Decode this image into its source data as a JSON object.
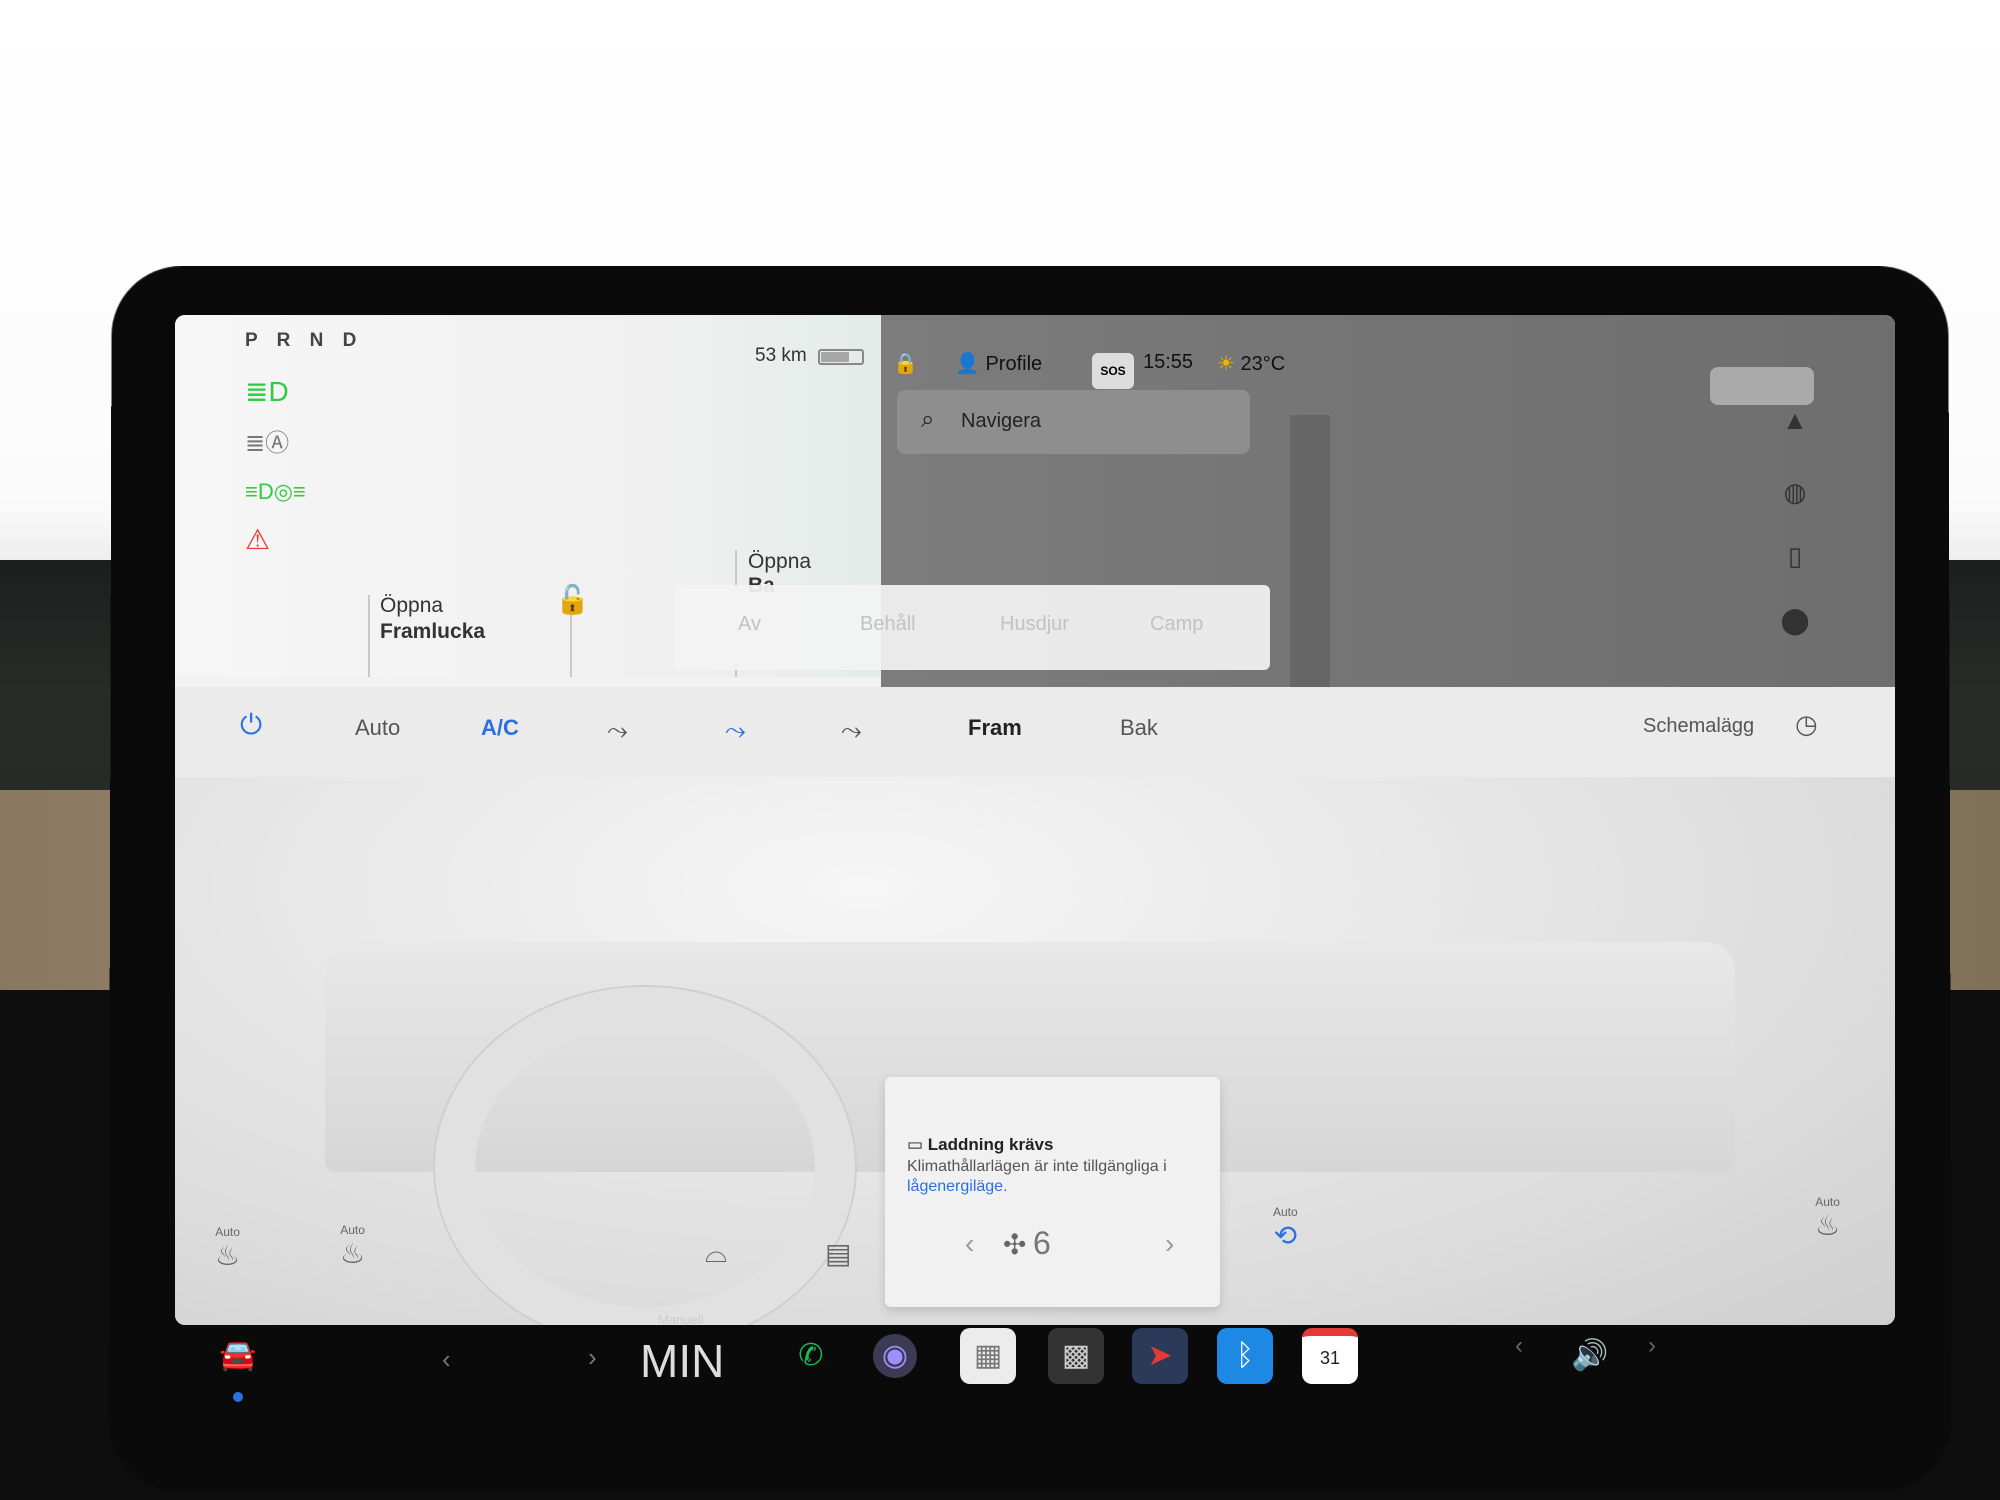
{
  "car_panel": {
    "gear": "P R N D",
    "range": "53 km",
    "battery_fraction": 0.7,
    "open_front_line1": "Öppna",
    "open_front_line2": "Framlucka",
    "open_back_line1": "Öppna",
    "open_back_line2": "Ba"
  },
  "topbar": {
    "profile": "Profile",
    "sos": "SOS",
    "time": "15:55",
    "temperature": "23°C"
  },
  "search": {
    "placeholder": "Navigera"
  },
  "climate_modes": [
    "Av",
    "Behåll",
    "Husdjur",
    "Camp"
  ],
  "climate_bar": {
    "auto": "Auto",
    "ac": "A/C",
    "front": "Fram",
    "rear": "Bak",
    "schedule": "Schemalägg"
  },
  "notice": {
    "title": "Laddning krävs",
    "body": "Klimathållarlägen är inte tillgängliga i ",
    "link": "lågenergiläge."
  },
  "bottom_controls": {
    "seat_auto_left": "Auto",
    "wheel_auto": "Auto",
    "recirc_auto": "Auto",
    "seat_auto_right": "Auto",
    "fan_speed": "6"
  },
  "dock": {
    "mode_label": "Manuell",
    "temp": "MIN",
    "calendar_day": "31"
  },
  "colors": {
    "accent_blue": "#2b6fe3",
    "light_green": "#2ecc40",
    "warning_red": "#e53935",
    "phone_green": "#1db954"
  }
}
